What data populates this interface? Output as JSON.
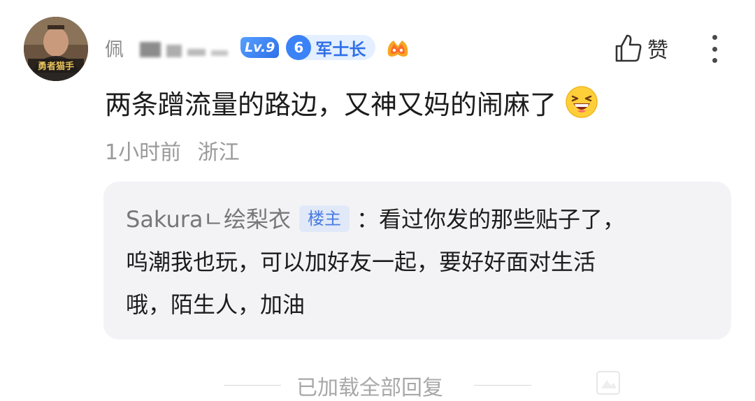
{
  "comment": {
    "username_visible": "佩",
    "level_badge": "Lv.9",
    "rank": {
      "number": "6",
      "title": "军士长"
    },
    "game_badge_icon": "game-logo-icon",
    "like_label": "赞",
    "text": "两条蹭流量的路边，又神又妈的闹麻了",
    "emoji_icon": "laughing-emoji-icon",
    "time": "1小时前",
    "location": "浙江"
  },
  "reply": {
    "author": "Sakuraㄴ绘梨衣",
    "owner_tag": "楼主",
    "lines": [
      "：看过你发的那些贴子了，",
      "呜潮我也玩，可以加好友一起，要好好面对生活",
      "哦，陌生人，加油"
    ]
  },
  "footer": {
    "loaded_text": "已加载全部回复"
  },
  "colors": {
    "accent_blue": "#3b82f6",
    "badge_bg": "#e4efff",
    "reply_bg": "#f3f3f6",
    "owner_tag_text": "#4a7be0",
    "meta_gray": "#9a9a9a"
  }
}
